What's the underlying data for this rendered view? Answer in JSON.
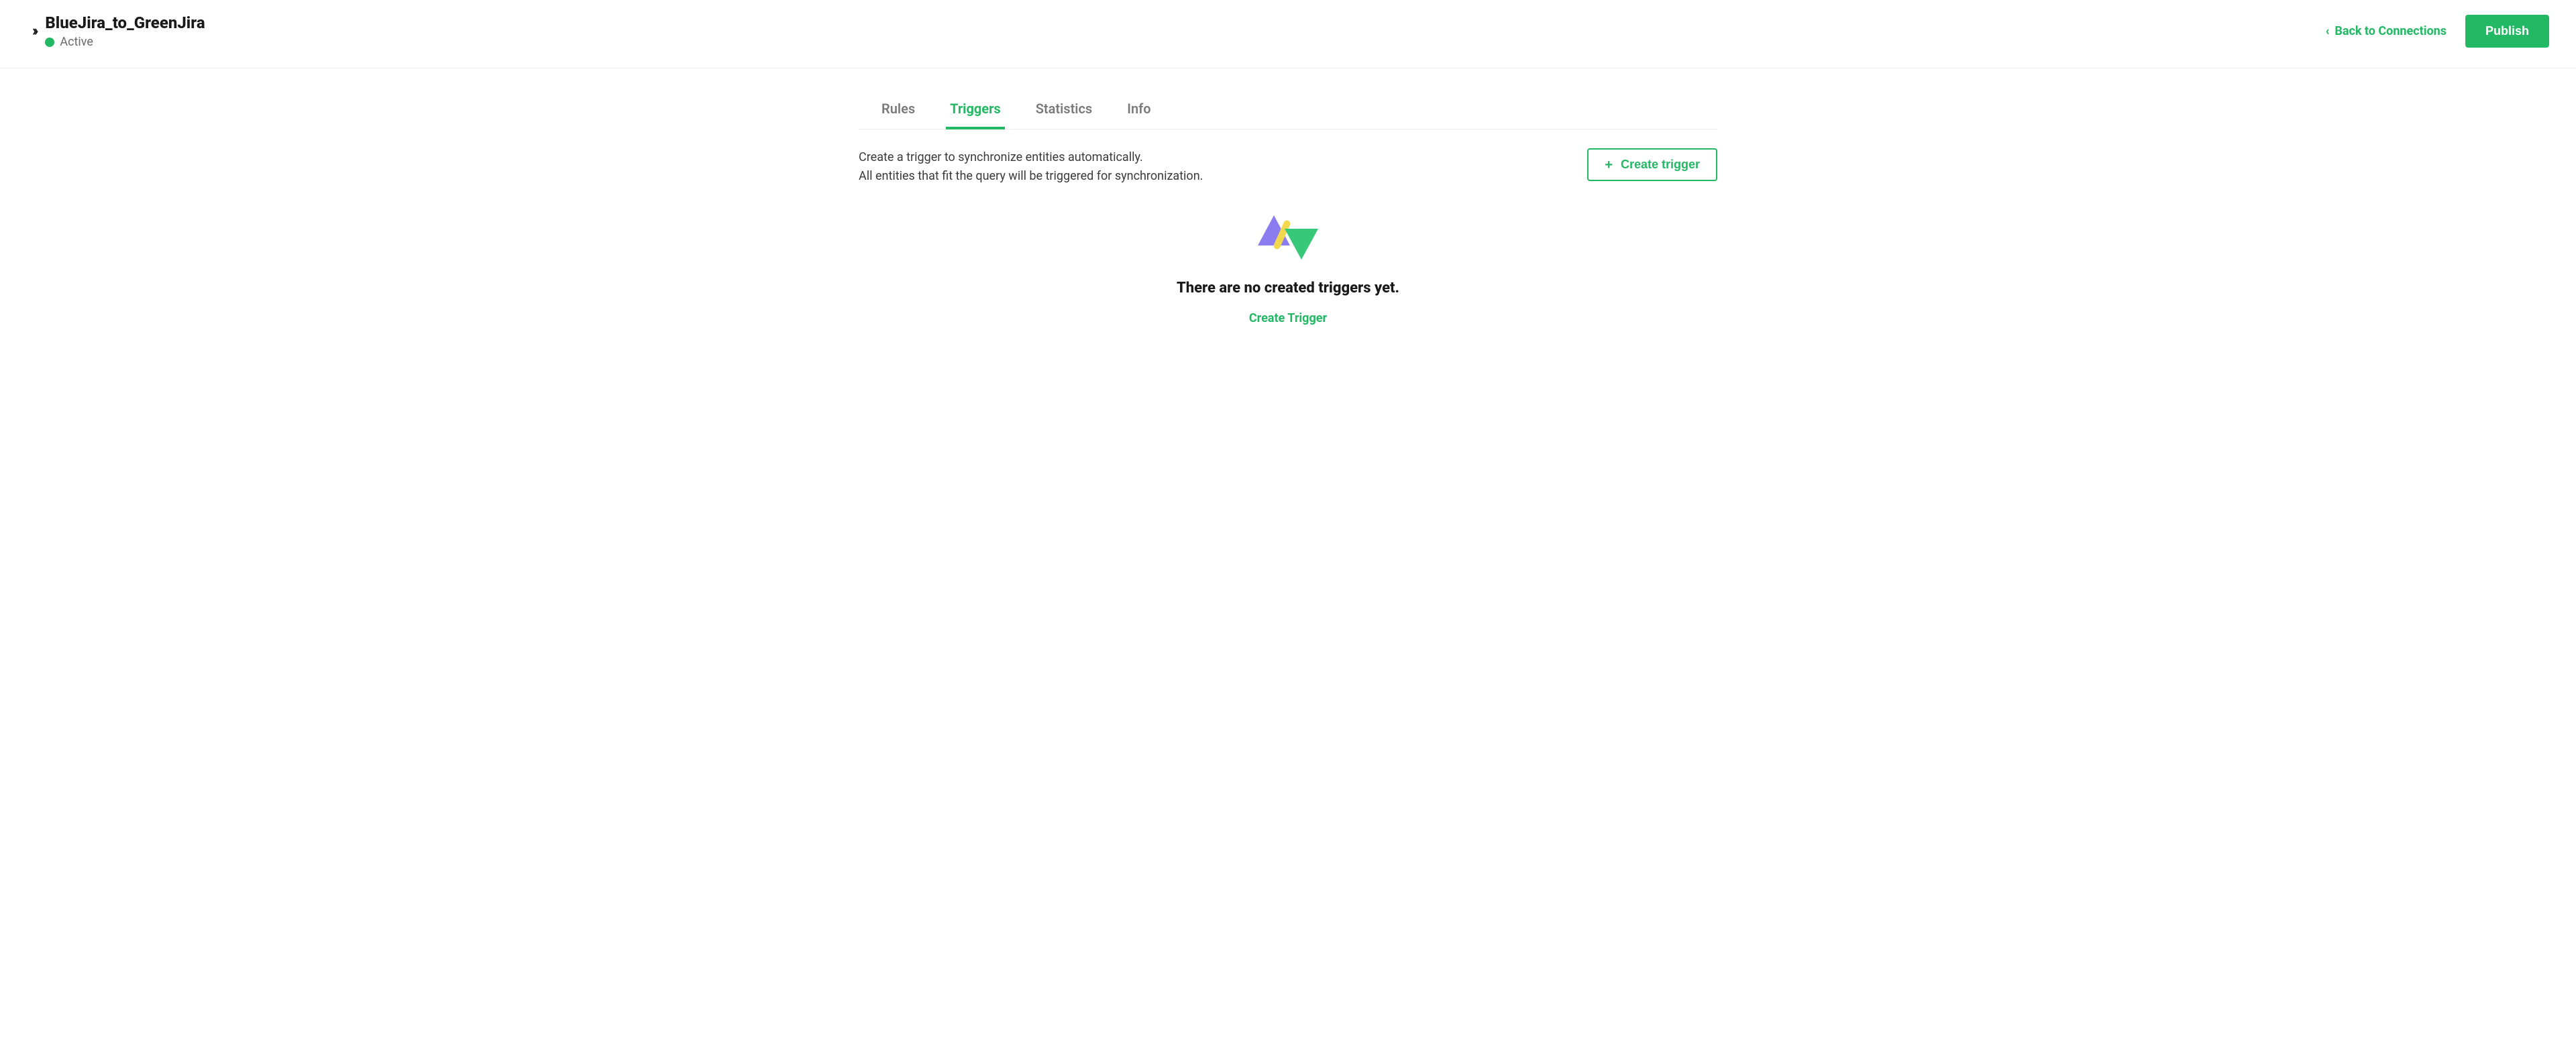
{
  "header": {
    "title": "BlueJira_to_GreenJira",
    "status_label": "Active",
    "status_color": "#22b864",
    "back_label": "Back to Connections",
    "publish_label": "Publish"
  },
  "tabs": [
    {
      "label": "Rules",
      "active": false
    },
    {
      "label": "Triggers",
      "active": true
    },
    {
      "label": "Statistics",
      "active": false
    },
    {
      "label": "Info",
      "active": false
    }
  ],
  "description": {
    "line1": "Create a trigger to synchronize entities automatically.",
    "line2": "All entities that fit the query will be triggered for synchronization."
  },
  "buttons": {
    "create_trigger": "Create trigger"
  },
  "empty_state": {
    "title": "There are no created triggers yet.",
    "link": "Create Trigger"
  }
}
